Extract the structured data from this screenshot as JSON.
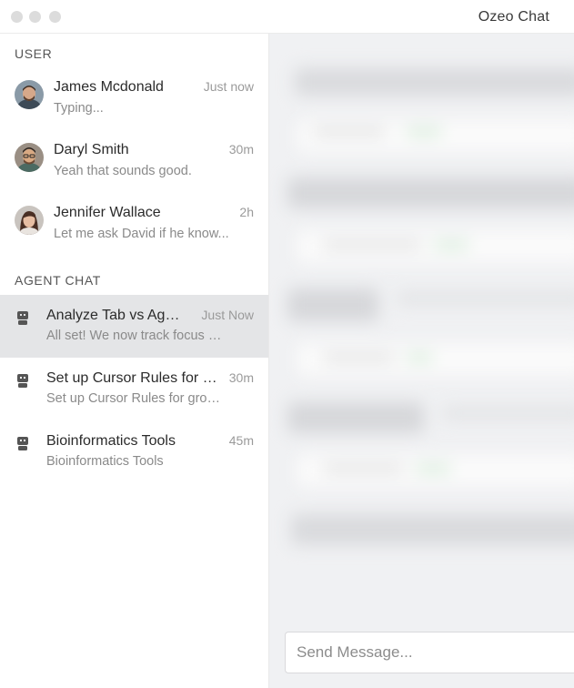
{
  "window": {
    "title": "Ozeo Chat"
  },
  "sidebar": {
    "user_section_title": "USER",
    "users": [
      {
        "name": "James Mcdonald",
        "preview": "Typing...",
        "time": "Just now"
      },
      {
        "name": "Daryl Smith",
        "preview": "Yeah that sounds good.",
        "time": "30m"
      },
      {
        "name": "Jennifer Wallace",
        "preview": "Let me ask David if he know...",
        "time": "2h"
      }
    ],
    "agent_section_title": "AGENT CHAT",
    "agents": [
      {
        "name": "Analyze Tab vs Agent Usage Patterns",
        "preview": "All set! We now track focus and usage",
        "time": "Just Now",
        "active": true
      },
      {
        "name": "Set up Cursor Rules for Dashboard",
        "preview": "Set up Cursor Rules for group settings",
        "time": "30m"
      },
      {
        "name": "Bioinformatics Tools",
        "preview": "Bioinformatics Tools",
        "time": "45m"
      }
    ]
  },
  "composer": {
    "placeholder": "Send Message..."
  },
  "colors": {
    "active_row": "#e4e5e7",
    "accent_green": "#cfe9d3"
  },
  "icons": {
    "agent": "robot-icon"
  }
}
